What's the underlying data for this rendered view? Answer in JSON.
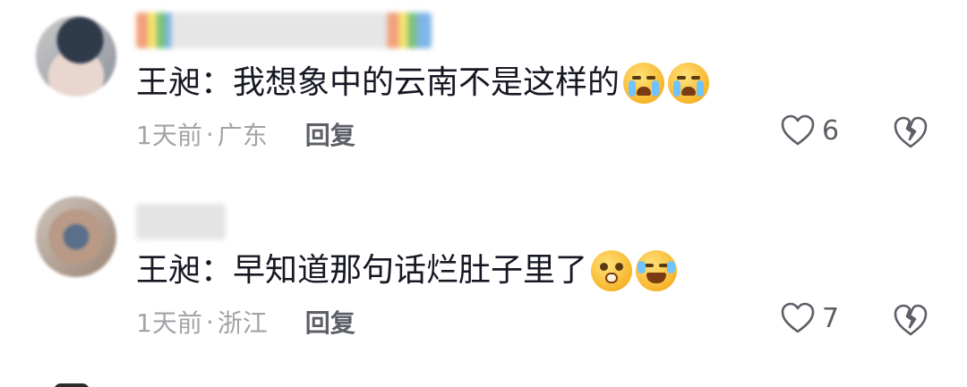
{
  "comments": [
    {
      "text": "王昶：我想象中的云南不是这样的",
      "emojis": [
        "crying-face",
        "crying-face"
      ],
      "time": "1天前",
      "location": "广东",
      "reply_label": "回复",
      "likes": "6"
    },
    {
      "text": "王昶：早知道那句话烂肚子里了",
      "emojis": [
        "pleading-face",
        "tears-of-joy-face"
      ],
      "time": "1天前",
      "location": "浙江",
      "reply_label": "回复",
      "likes": "7"
    }
  ],
  "meta_separator": "·",
  "colors": {
    "text": "#161823",
    "meta": "#a3a3a8",
    "action": "#5c5f66"
  }
}
